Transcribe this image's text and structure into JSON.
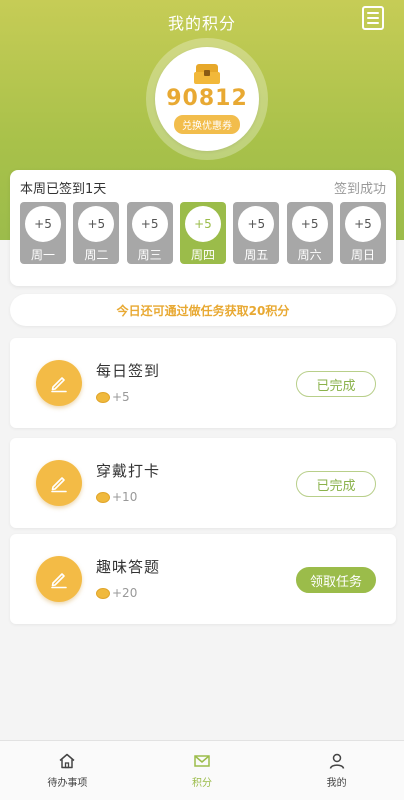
{
  "header": {
    "title": "我的积分"
  },
  "points": {
    "value": "90812",
    "redeem_label": "兑换优惠券"
  },
  "week": {
    "title": "本周已签到1天",
    "status": "签到成功",
    "days": [
      {
        "reward": "+5",
        "label": "周一",
        "active": false
      },
      {
        "reward": "+5",
        "label": "周二",
        "active": false
      },
      {
        "reward": "+5",
        "label": "周三",
        "active": false
      },
      {
        "reward": "+5",
        "label": "周四",
        "active": true
      },
      {
        "reward": "+5",
        "label": "周五",
        "active": false
      },
      {
        "reward": "+5",
        "label": "周六",
        "active": false
      },
      {
        "reward": "+5",
        "label": "周日",
        "active": false
      }
    ]
  },
  "tip": "今日还可通过做任务获取20积分",
  "tasks": [
    {
      "name": "每日签到",
      "reward": "+5",
      "button": "已完成",
      "state": "done"
    },
    {
      "name": "穿戴打卡",
      "reward": "+10",
      "button": "已完成",
      "state": "done"
    },
    {
      "name": "趣味答题",
      "reward": "+20",
      "button": "领取任务",
      "state": "todo"
    }
  ],
  "tabs": [
    {
      "label": "待办事项",
      "icon": "home-icon"
    },
    {
      "label": "积分",
      "icon": "mail-icon"
    },
    {
      "label": "我的",
      "icon": "user-icon"
    }
  ],
  "colors": {
    "accent": "#9bbc4a",
    "gold": "#e8a933",
    "orange": "#f3bb46"
  }
}
